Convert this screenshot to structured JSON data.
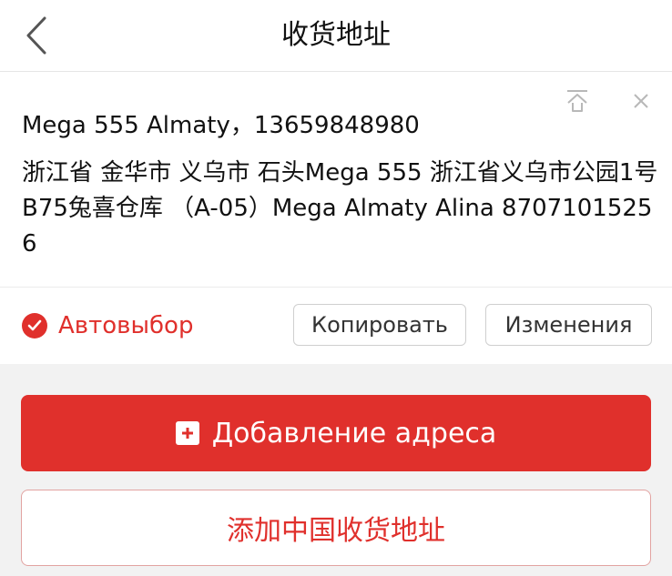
{
  "header": {
    "title": "收货地址",
    "back_icon": "chevron-left-icon"
  },
  "address": {
    "name_phone": "Mega 555 Almaty，13659848980",
    "detail": "浙江省 金华市 义乌市 石头Mega 555 浙江省义乌市公园1号B75兔喜仓库 （A-05）Mega Almaty Alina 87071015256",
    "pin_icon": "pin-to-top-icon",
    "close_icon": "close-icon"
  },
  "actions": {
    "auto_select_label": "Автовыбор",
    "auto_select_checked": true,
    "copy_label": "Копировать",
    "edit_label": "Изменения"
  },
  "buttons": {
    "add_address_label": "Добавление адреса",
    "add_china_address_label": "添加中国收货地址"
  },
  "colors": {
    "accent": "#e0302c",
    "background": "#f2f2f2",
    "card": "#ffffff",
    "border": "#cfcfcf"
  }
}
